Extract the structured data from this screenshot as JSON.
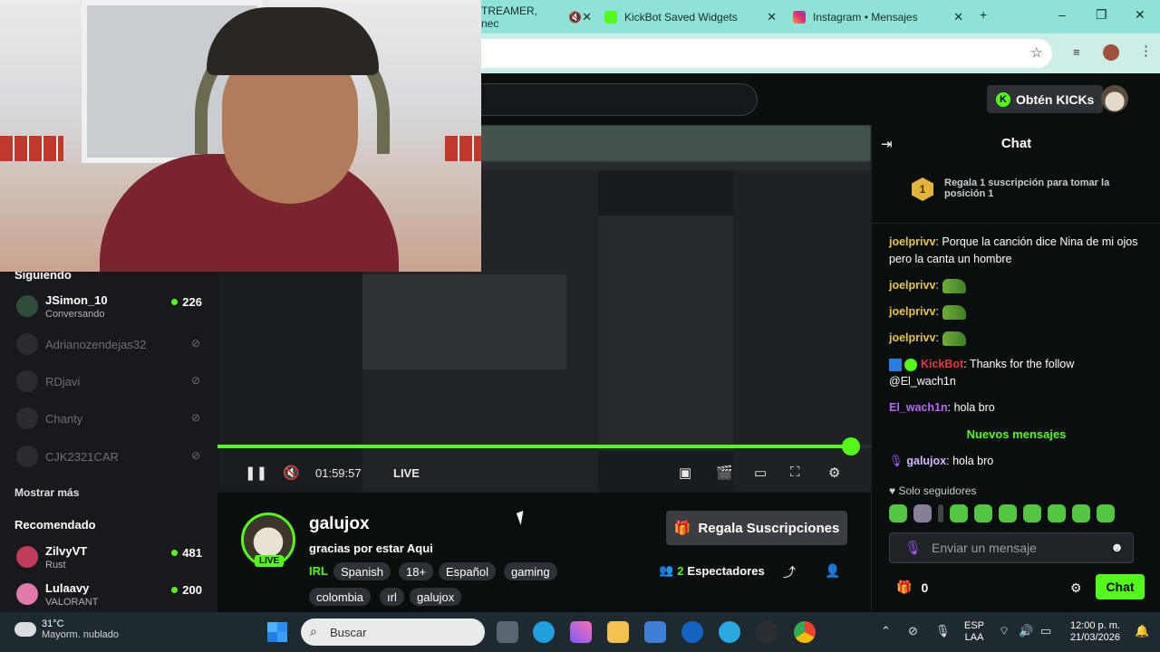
{
  "browser": {
    "tabs": [
      {
        "title": "TREAMER, nec",
        "muted": true
      },
      {
        "title": "KickBot Saved Widgets"
      },
      {
        "title": "Instagram • Mensajes"
      }
    ],
    "new_tab": "+",
    "minimize": "–",
    "maximize": "❐",
    "close": "✕"
  },
  "kick": {
    "kicks_button": "Obtén KICKs"
  },
  "sidebar": {
    "following_title": "Siguiendo",
    "following": [
      {
        "name": "JSimon_10",
        "status": "Conversando",
        "viewers": "226",
        "live": true
      },
      {
        "name": "Adrianozendejas32",
        "live": false
      },
      {
        "name": "RDjavi",
        "live": false
      },
      {
        "name": "Chanty",
        "live": false
      },
      {
        "name": "CJK2321CAR",
        "live": false
      }
    ],
    "show_more": "Mostrar más",
    "recommended_title": "Recomendado",
    "recommended": [
      {
        "name": "ZilvyVT",
        "status": "Rust",
        "viewers": "481"
      },
      {
        "name": "Lulaavy",
        "status": "VALORANT",
        "viewers": "200"
      }
    ]
  },
  "player": {
    "time": "01:59:57",
    "live_label": "LIVE",
    "progress": 0.97
  },
  "stream": {
    "streamer": "galujox",
    "live_badge": "LIVE",
    "title": "gracias por  estar Aqui",
    "category": "IRL",
    "tags_row1": [
      "Spanish",
      "18+",
      "Español",
      "gaming"
    ],
    "tags_row2": [
      "colombia",
      "ırl",
      "galujox"
    ],
    "gift_button": "Regala Suscripciones",
    "viewer_count": "2",
    "viewer_label": "Espectadores"
  },
  "chat": {
    "title": "Chat",
    "pinned_rank": "1",
    "pinned_text": "Regala 1 suscripción para tomar la posición 1",
    "messages": [
      {
        "user": "joelprivv",
        "color": "#e8c547",
        "text": "Porque la canción dice Nina de mi ojos pero la canta un hombre"
      },
      {
        "user": "joelprivv",
        "color": "#e8c547",
        "text": "",
        "emote": true
      },
      {
        "user": "joelprivv",
        "color": "#e8c547",
        "text": "",
        "emote": true
      },
      {
        "user": "joelprivv",
        "color": "#e8c547",
        "text": "",
        "emote": true
      },
      {
        "user": "KickBot",
        "color": "#e23b3b",
        "text": "Thanks for the follow @El_wach1n"
      },
      {
        "user": "El_wach1n",
        "color": "#b567f5",
        "text": "hola bro"
      }
    ],
    "new_messages": "Nuevos mensajes",
    "last_message": {
      "user": "galujox",
      "color": "#d6b7ff",
      "text": "hola bro"
    },
    "followers_only": "Solo seguidores",
    "input_placeholder": "Enviar un mensaje",
    "points": "0",
    "send_button": "Chat"
  },
  "taskbar": {
    "temperature": "31°C",
    "weather": "Mayorm. nublado",
    "search_placeholder": "Buscar",
    "lang1": "ESP",
    "lang2": "LAA",
    "time": "12:00 p. m.",
    "date": "21/03/2026"
  }
}
